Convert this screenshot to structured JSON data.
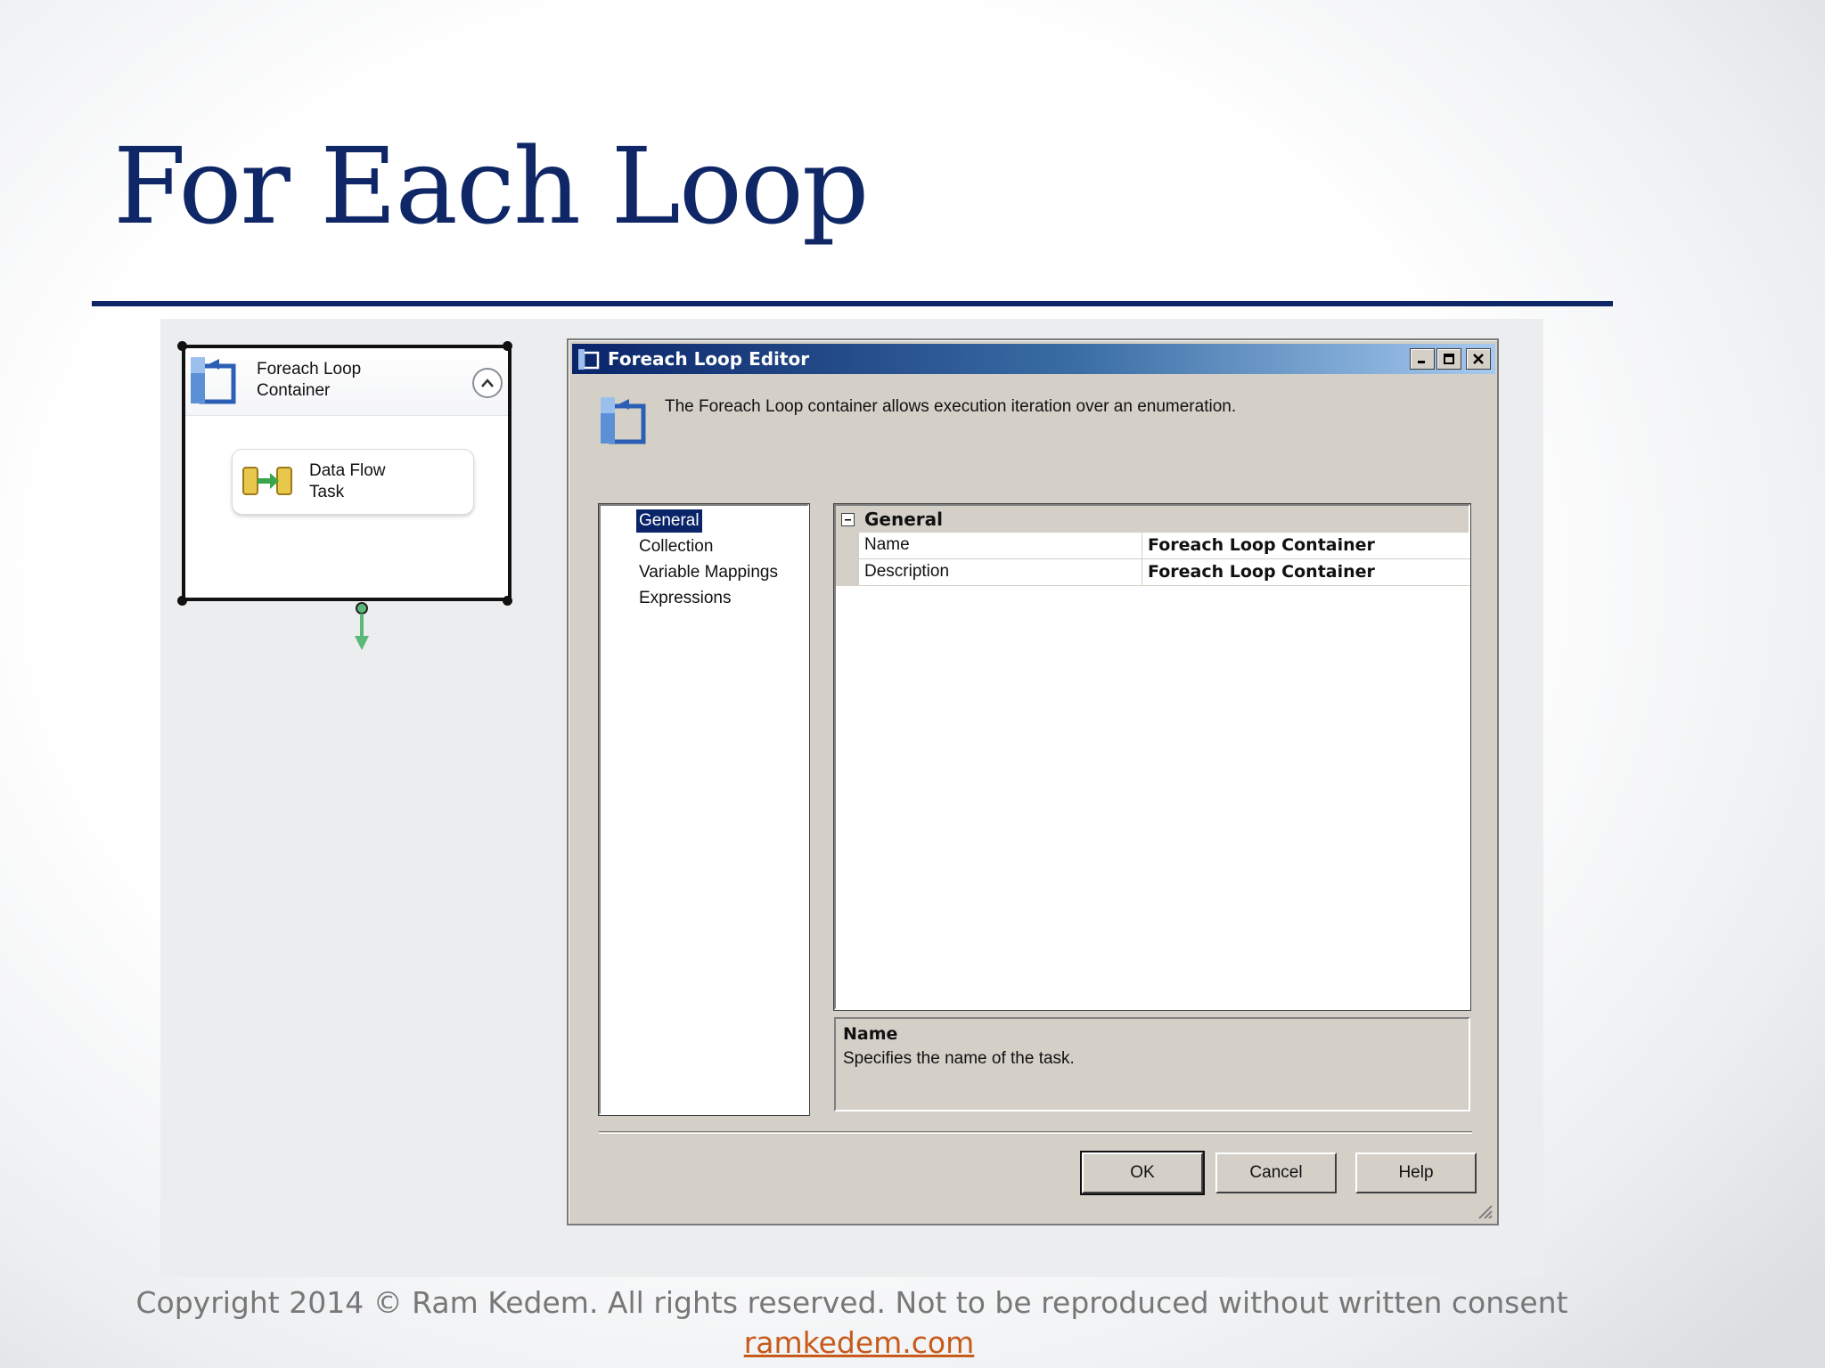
{
  "slide": {
    "title": "For Each Loop",
    "footer_copyright": "Copyright 2014 © Ram Kedem. All rights reserved. Not to be reproduced without written consent",
    "footer_link": "ramkedem.com"
  },
  "container": {
    "title": "Foreach Loop Container",
    "task_label": "Data Flow Task"
  },
  "dialog": {
    "title": "Foreach Loop Editor",
    "description": "The Foreach Loop container allows execution iteration over an enumeration.",
    "nav_items": [
      {
        "label": "General",
        "selected": true
      },
      {
        "label": "Collection",
        "selected": false
      },
      {
        "label": "Variable Mappings",
        "selected": false
      },
      {
        "label": "Expressions",
        "selected": false
      }
    ],
    "category": "General",
    "properties": [
      {
        "name": "Name",
        "value": "Foreach Loop Container"
      },
      {
        "name": "Description",
        "value": "Foreach Loop Container"
      }
    ],
    "help_title": "Name",
    "help_text": "Specifies the name of the task.",
    "buttons": {
      "ok": "OK",
      "cancel": "Cancel",
      "help": "Help"
    }
  },
  "colors": {
    "title_blue": "#0f2766",
    "titlebar_start": "#0a246a",
    "titlebar_end": "#a6caf0",
    "dialog_face": "#d4d0c8",
    "link_orange": "#c85a1a",
    "connector_green": "#5cb87a"
  },
  "icons": [
    "foreach-loop-icon",
    "collapse-chevron-icon",
    "data-flow-task-icon",
    "minimize-icon",
    "maximize-icon",
    "close-icon",
    "resize-grip-icon"
  ]
}
